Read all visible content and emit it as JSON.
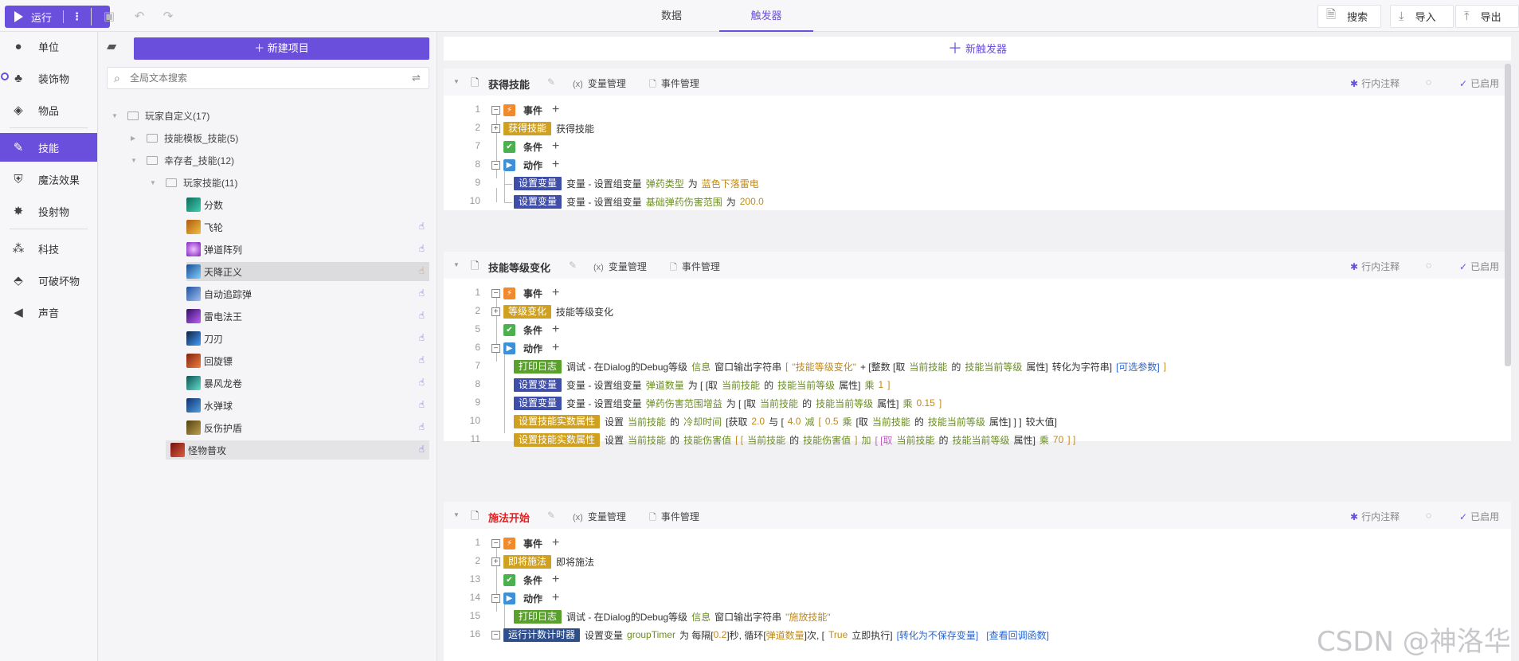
{
  "toolbar": {
    "run_label": "运行",
    "tabs": [
      "数据",
      "触发器"
    ],
    "search_label": "搜索",
    "import_label": "导入",
    "export_label": "导出"
  },
  "nav": {
    "items": [
      "单位",
      "装饰物",
      "物品",
      "技能",
      "魔法效果",
      "投射物",
      "科技",
      "可破坏物",
      "声音"
    ]
  },
  "tree": {
    "new_project_label": "新建项目",
    "search_placeholder": "全局文本搜索",
    "root": "玩家自定义(17)",
    "nodes": [
      "技能模板_技能(5)",
      "幸存者_技能(12)",
      "玩家技能(11)"
    ],
    "skills": [
      "分数",
      "飞轮",
      "弹道阵列",
      "天降正义",
      "自动追踪弹",
      "雷电法王",
      "刀刃",
      "回旋镖",
      "暴风龙卷",
      "水弹球",
      "反伤护盾",
      "怪物普攻"
    ]
  },
  "main": {
    "new_trigger_label": "新触发器",
    "var_manage": "变量管理",
    "event_manage": "事件管理",
    "inline_comment": "行内注释",
    "enabled": "已启用",
    "event_label": "事件",
    "condition_label": "条件",
    "action_label": "动作",
    "triggers": [
      {
        "title": "获得技能",
        "lines": [
          "1",
          "2",
          "7",
          "8",
          "9",
          "10"
        ],
        "event_tag": "获得技能",
        "event_text": "获得技能",
        "actions": [
          {
            "tag": "设置变量",
            "text": "变量 - 设置组变量",
            "var": "弹药类型",
            "op": "为",
            "val": "蓝色下落雷电"
          },
          {
            "tag": "设置变量",
            "text": "变量 - 设置组变量",
            "var": "基础弹药伤害范围",
            "op": "为",
            "val": "200.0"
          }
        ]
      },
      {
        "title": "技能等级变化",
        "lines": [
          "1",
          "2",
          "5",
          "6",
          "7",
          "8",
          "9",
          "10",
          "11"
        ],
        "event_tag": "等级变化",
        "event_text": "技能等级变化",
        "a1": {
          "tag": "打印日志",
          "p1": "调试 - 在Dialog的Debug等级",
          "p2": "信息",
          "p3": "窗口输出字符串",
          "p4": "[",
          "p5": "\"技能等级变化\"",
          "p6": "+ [整数 [取",
          "p7": "当前技能",
          "p8": "的",
          "p9": "技能当前等级",
          "p10": "属性]",
          "p11": "转化为字符串]",
          "p12": "[可选参数]",
          "p13": "]"
        },
        "a2": {
          "tag": "设置变量",
          "p1": "变量 - 设置组变量",
          "p2": "弹道数量",
          "p3": "为 [ [取",
          "p4": "当前技能",
          "p5": "的",
          "p6": "技能当前等级",
          "p7": "属性]",
          "p8": "乘",
          "p9": "1",
          "p10": "]"
        },
        "a3": {
          "tag": "设置变量",
          "p1": "变量 - 设置组变量",
          "p2": "弹药伤害范围增益",
          "p3": "为 [ [取",
          "p4": "当前技能",
          "p5": "的",
          "p6": "技能当前等级",
          "p7": "属性]",
          "p8": "乘",
          "p9": "0.15",
          "p10": "]"
        },
        "a4": {
          "tag": "设置技能实数属性",
          "p1": "设置",
          "p2": "当前技能",
          "p3": "的",
          "p4": "冷却时间",
          "p5": "[获取",
          "p6": "2.0",
          "p7": "与 [",
          "p8": "4.0",
          "p9": "减",
          "p10": "[",
          "p11": "0.5",
          "p12": "乘",
          "p13": "[取",
          "p14": "当前技能",
          "p15": "的",
          "p16": "技能当前等级",
          "p17": "属性] ] ]",
          "p18": "较大值]"
        },
        "a5": {
          "tag": "设置技能实数属性",
          "p1": "设置",
          "p2": "当前技能",
          "p3": "的",
          "p4": "技能伤害值",
          "p5": "[ [",
          "p6": "当前技能",
          "p7": "的",
          "p8": "技能伤害值",
          "p9": "]",
          "p10": "加",
          "p11": "[ [取",
          "p12": "当前技能",
          "p13": "的",
          "p14": "技能当前等级",
          "p15": "属性]",
          "p16": "乘",
          "p17": "70",
          "p18": "] ]"
        }
      },
      {
        "title": "施法开始",
        "lines": [
          "1",
          "2",
          "13",
          "14",
          "15",
          "16"
        ],
        "event_tag": "即将施法",
        "event_text": "即将施法",
        "a1": {
          "tag": "打印日志",
          "p1": "调试 - 在Dialog的Debug等级",
          "p2": "信息",
          "p3": "窗口输出字符串",
          "p4": "\"施放技能\""
        },
        "a2": {
          "tag": "运行计数计时器",
          "p1": "设置变量",
          "p2": "groupTimer",
          "p3": "为 每隔[",
          "p4": "0.2",
          "p5": "]秒, 循环[",
          "p6": "弹道数量",
          "p7": "]次, [",
          "p8": "True",
          "p9": "立即执行]",
          "p10": "[转化为不保存变量]",
          "p11": "[查看回调函数]"
        }
      }
    ]
  },
  "watermark": "CSDN @神洛华",
  "colors": {
    "accent": "#6a4fdc",
    "tag_yellow": "#d0a020",
    "tag_blue": "#3f4ea8",
    "tag_green": "#5aa02c"
  }
}
